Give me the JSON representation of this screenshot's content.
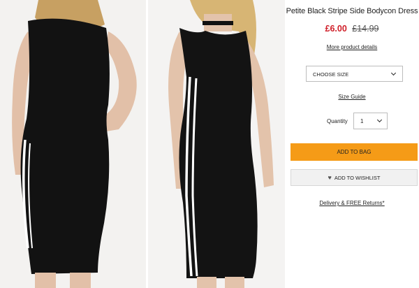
{
  "product": {
    "title": "Petite Black Stripe Side Bodycon Dress",
    "price_now": "£6.00",
    "price_was": "£14.99"
  },
  "links": {
    "more_details": "More product details",
    "size_guide": "Size Guide",
    "delivery": "Delivery & FREE Returns*"
  },
  "size_select": {
    "selected": "CHOOSE SIZE"
  },
  "quantity": {
    "label": "Quantity",
    "selected": "1"
  },
  "buttons": {
    "add_to_bag": "ADD TO BAG",
    "add_to_wishlist": "ADD TO WISHLIST"
  },
  "icons": {
    "wishlist": "heart-icon",
    "dropdown": "chevron-down-icon"
  },
  "colors": {
    "sale_price": "#d0202a",
    "add_to_bag_bg": "#f59b17",
    "dress": "#111111",
    "stripe": "#ffffff"
  }
}
